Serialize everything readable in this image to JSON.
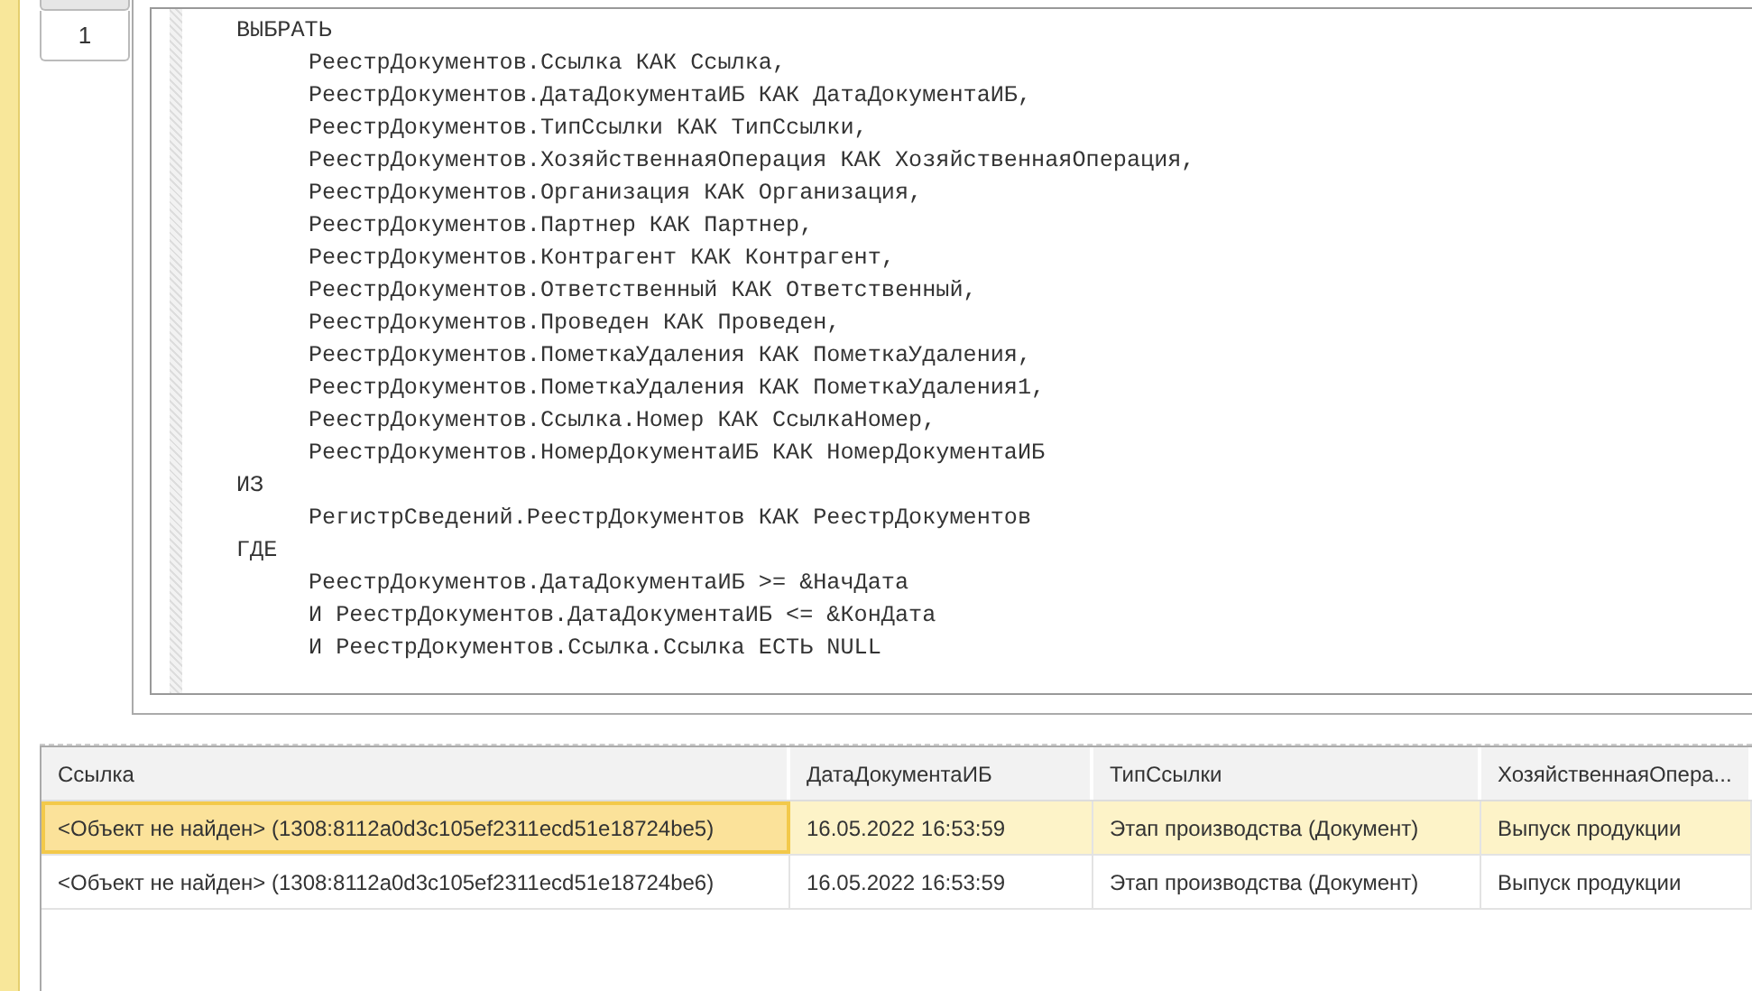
{
  "tabs": [
    {
      "label": "1",
      "selected": true
    }
  ],
  "query": {
    "clauses": [
      {
        "keyword": "ВЫБРАТЬ",
        "lines": [
          "РеестрДокументов.Ссылка КАК Ссылка,",
          "РеестрДокументов.ДатаДокументаИБ КАК ДатаДокументаИБ,",
          "РеестрДокументов.ТипСсылки КАК ТипСсылки,",
          "РеестрДокументов.ХозяйственнаяОперация КАК ХозяйственнаяОперация,",
          "РеестрДокументов.Организация КАК Организация,",
          "РеестрДокументов.Партнер КАК Партнер,",
          "РеестрДокументов.Контрагент КАК Контрагент,",
          "РеестрДокументов.Ответственный КАК Ответственный,",
          "РеестрДокументов.Проведен КАК Проведен,",
          "РеестрДокументов.ПометкаУдаления КАК ПометкаУдаления,",
          "РеестрДокументов.ПометкаУдаления КАК ПометкаУдаления1,",
          "РеестрДокументов.Ссылка.Номер КАК СсылкаНомер,",
          "РеестрДокументов.НомерДокументаИБ КАК НомерДокументаИБ"
        ]
      },
      {
        "keyword": "ИЗ",
        "lines": [
          "РегистрСведений.РеестрДокументов КАК РеестрДокументов"
        ]
      },
      {
        "keyword": "ГДЕ",
        "lines": [
          "РеестрДокументов.ДатаДокументаИБ >= &НачДата",
          "И РеестрДокументов.ДатаДокументаИБ <= &КонДата",
          "И РеестрДокументов.Ссылка.Ссылка ЕСТЬ NULL"
        ]
      }
    ]
  },
  "table": {
    "columns": [
      "Ссылка",
      "ДатаДокументаИБ",
      "ТипСсылки",
      "ХозяйственнаяОпера..."
    ],
    "rows": [
      {
        "selected": true,
        "cells": [
          "<Объект не найден> (1308:8112a0d3c105ef2311ecd51e18724be5)",
          "16.05.2022 16:53:59",
          "Этап производства (Документ)",
          "Выпуск продукции"
        ]
      },
      {
        "selected": false,
        "cells": [
          "<Объект не найден> (1308:8112a0d3c105ef2311ecd51e18724be6)",
          "16.05.2022 16:53:59",
          "Этап производства (Документ)",
          "Выпуск продукции"
        ]
      }
    ]
  }
}
